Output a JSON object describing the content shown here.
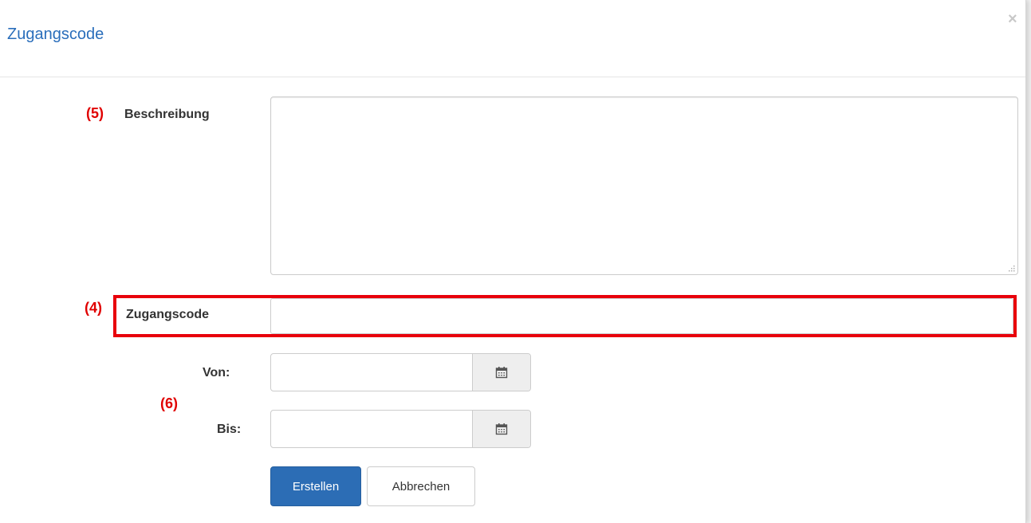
{
  "dialog": {
    "title": "Zugangscode",
    "close_symbol": "×"
  },
  "annotations": {
    "beschreibung": "(5)",
    "zugangscode": "(4)",
    "dates": "(6)"
  },
  "form": {
    "description_label": "Beschreibung",
    "description_value": "",
    "accesscode_label": "Zugangscode",
    "accesscode_value": "",
    "from_label": "Von:",
    "from_value": "",
    "to_label": "Bis:",
    "to_value": "",
    "calendar_icon": "calendar-icon"
  },
  "buttons": {
    "create_label": "Erstellen",
    "cancel_label": "Abbrechen"
  },
  "colors": {
    "title": "#2a6ebb",
    "annotation": "#e00000",
    "highlight_border": "#e8000b",
    "primary_button": "#2c6db5"
  }
}
